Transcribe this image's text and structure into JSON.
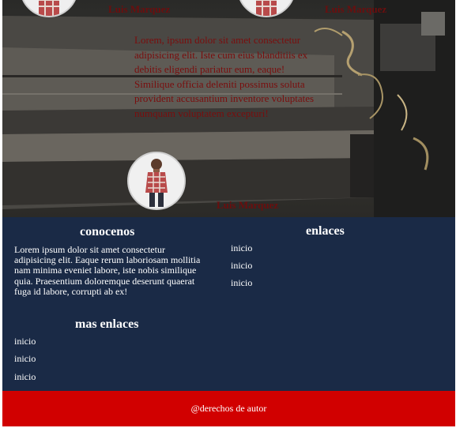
{
  "hero": {
    "authors": [
      "Luis Marquez",
      "Luis Marquez",
      "Luis Marquez"
    ],
    "quote": "Lorem, ipsum dolor sit amet consectetur adipisicing elit. Iste cum eius blanditiis ex debitis eligendi pariatur eum, eaque! Similique officia deleniti possimus soluta provident accusantium inventore voluptates numquam voluptatem excepturi!"
  },
  "footer": {
    "about": {
      "title": "conocenos",
      "text": "Lorem ipsum dolor sit amet consectetur adipisicing elit. Eaque rerum laboriosam mollitia nam minima eveniet labore, iste nobis similique quia. Praesentium doloremque deserunt quaerat fuga id labore, corrupti ab ex!"
    },
    "links": {
      "title": "enlaces",
      "items": [
        "inicio",
        "inicio",
        "inicio"
      ]
    },
    "more_links": {
      "title": "mas enlaces",
      "items": [
        "inicio",
        "inicio",
        "inicio"
      ]
    }
  },
  "copyright": "@derechos de autor",
  "colors": {
    "footer_bg": "#1a2a46",
    "copyright_bg": "#d10000",
    "author_text": "#6b0e0e"
  }
}
